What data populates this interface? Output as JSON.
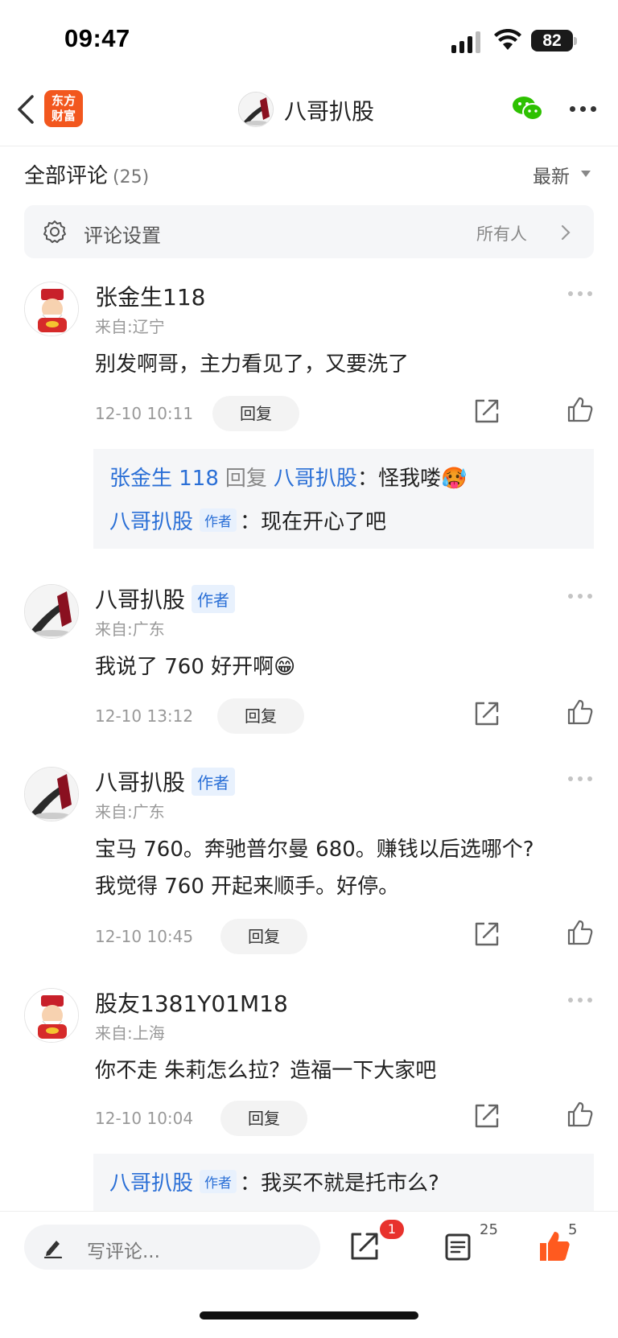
{
  "status_bar": {
    "time": "09:47",
    "battery": "82"
  },
  "nav": {
    "title": "八哥扒股",
    "logo_line1": "东方",
    "logo_line2": "财富"
  },
  "header": {
    "title": "全部评论",
    "count": "(25)",
    "sort_label": "最新"
  },
  "settings": {
    "label": "评论设置",
    "value": "所有人"
  },
  "comments": [
    {
      "name": "张金生118",
      "author_tag": "",
      "location": "来自:辽宁",
      "text": "别发啊哥，主力看见了，又要洗了",
      "time": "12-10 10:11",
      "reply_label": "回复",
      "replies": [
        {
          "from": "张金生 118",
          "verb": "回复",
          "to": "八哥扒股",
          "sep": "：",
          "text": "怪我喽🥵"
        },
        {
          "from": "八哥扒股",
          "tag": "作者",
          "sep": "：",
          "text": "现在开心了吧"
        }
      ]
    },
    {
      "name": "八哥扒股",
      "author_tag": "作者",
      "location": "来自:广东",
      "text": "我说了 760 好开啊😁",
      "time": "12-10 13:12",
      "reply_label": "回复"
    },
    {
      "name": "八哥扒股",
      "author_tag": "作者",
      "location": "来自:广东",
      "text_line1": "宝马 760。奔驰普尔曼 680。赚钱以后选哪个?",
      "text_line2": "我觉得 760 开起来顺手。好停。",
      "time": "12-10 10:45",
      "reply_label": "回复"
    },
    {
      "name": "股友1381Y01M18",
      "author_tag": "",
      "location": "来自:上海",
      "text": "你不走 朱莉怎么拉？造福一下大家吧",
      "time": "12-10 10:04",
      "reply_label": "回复",
      "replies": [
        {
          "from": "八哥扒股",
          "tag": "作者",
          "sep": "：",
          "text": "我买不就是托市么?"
        }
      ]
    }
  ],
  "bottom_bar": {
    "placeholder": "写评论...",
    "share_badge": "1",
    "comment_count": "25",
    "like_count": "5"
  },
  "colors": {
    "brand_orange": "#f2571e",
    "link_blue": "#2a6fd6",
    "like_orange": "#ff5a1f",
    "badge_red": "#e8322d"
  }
}
